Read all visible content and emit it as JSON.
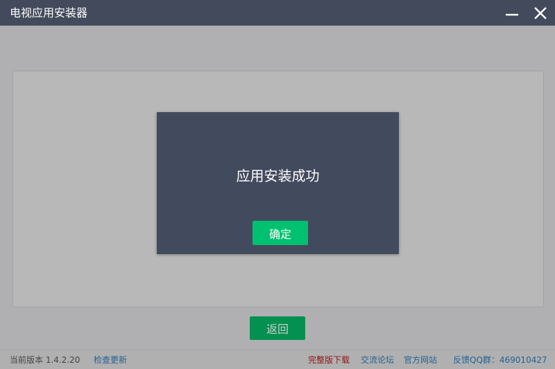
{
  "window": {
    "title": "电视应用安装器",
    "colors": {
      "titlebar": "#424a5c",
      "accent_green": "#00c170"
    }
  },
  "main": {
    "back_button_label": "返回"
  },
  "dialog": {
    "message": "应用安装成功",
    "confirm_label": "确定"
  },
  "statusbar": {
    "version_text": "当前版本 1.4.2.20",
    "check_update_label": "检查更新",
    "full_download_label": "完整版下载",
    "forum_label": "交流论坛",
    "official_site_label": "官方网站",
    "feedback_label": "反馈QQ群：469010427"
  }
}
